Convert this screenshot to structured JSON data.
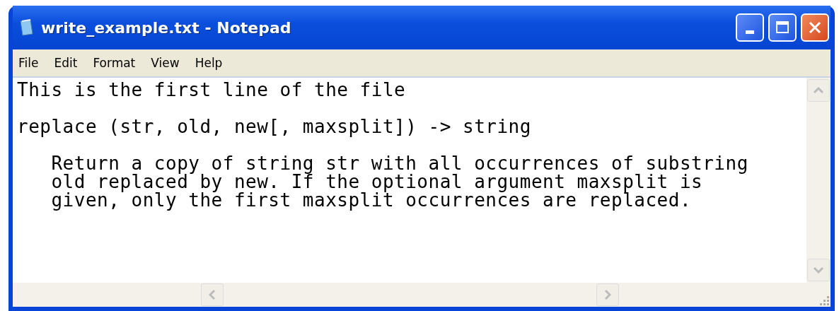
{
  "window": {
    "title": "write_example.txt - Notepad"
  },
  "menu": [
    {
      "label": "File"
    },
    {
      "label": "Edit"
    },
    {
      "label": "Format"
    },
    {
      "label": "View"
    },
    {
      "label": "Help"
    }
  ],
  "document": {
    "paragraphs": [
      [
        "This is the first line of the file"
      ],
      [
        "replace (str, old, new[, maxsplit]) -> string"
      ],
      [
        "   Return a copy of string str with all occurrences of substring",
        "   old replaced by new. If the optional argument maxsplit is",
        "   given, only the first maxsplit occurrences are replaced."
      ]
    ]
  }
}
